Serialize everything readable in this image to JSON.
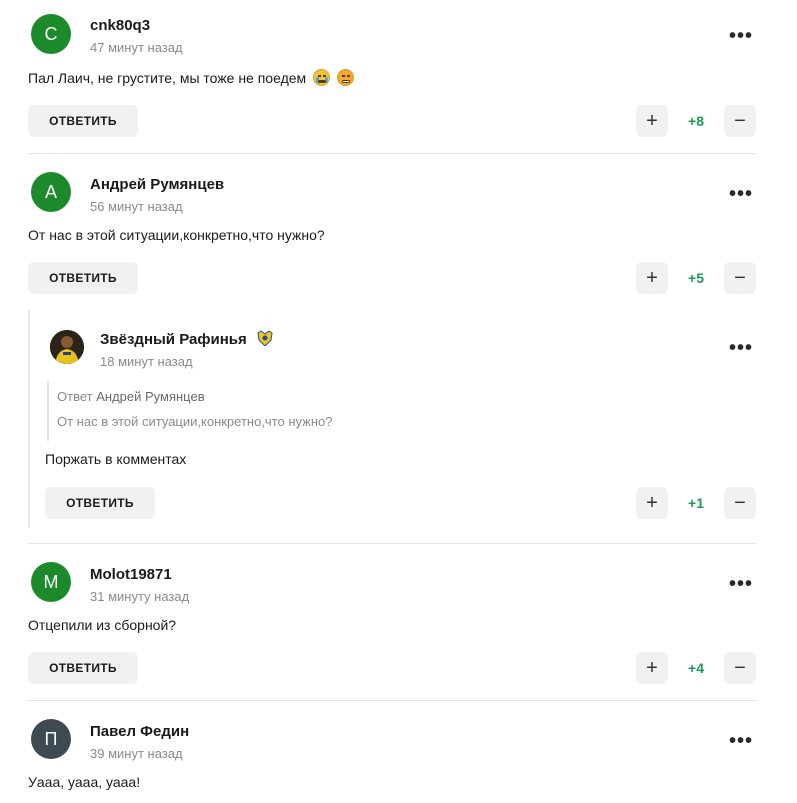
{
  "comments": [
    {
      "author": "cnk80q3",
      "avatar_letter": "C",
      "time": "47 минут назад",
      "text": "Пал Лаич, не грустите, мы тоже не поедем",
      "emojis": [
        "loudly-crying-face-emoji",
        "face-with-symbols-emoji"
      ],
      "reply_label": "ОТВЕТИТЬ",
      "score": "+8"
    },
    {
      "author": "Андрей Румянцев",
      "avatar_letter": "А",
      "time": "56 минут назад",
      "text": "От нас в этой ситуации,конкретно,что нужно?",
      "reply_label": "ОТВЕТИТЬ",
      "score": "+5"
    },
    {
      "author": "Molot19871",
      "avatar_letter": "M",
      "time": "31 минуту назад",
      "text": "Отцепили из сборной?",
      "reply_label": "ОТВЕТИТЬ",
      "score": "+4"
    },
    {
      "author": "Павел Федин",
      "avatar_letter": "П",
      "time": "39 минут назад",
      "text": "Уааа, уааа, уааа!"
    }
  ],
  "reply": {
    "author": "Звёздный Рафинья",
    "badge": "club-badge-icon",
    "time": "18 минут назад",
    "quote_prefix": "Ответ",
    "quote_author": "Андрей Румянцев",
    "quote_text": "От нас в этой ситуации,конкретно,что нужно?",
    "text": "Поржать в комментах",
    "reply_label": "ОТВЕТИТЬ",
    "score": "+1"
  },
  "controls": {
    "upvote": "+",
    "downvote": "−",
    "more": "•••"
  },
  "colors": {
    "avatar_green": "#1c8a2b",
    "avatar_slate": "#3d4a52",
    "score_green": "#1e9b57",
    "button_bg": "#f1f1f1"
  }
}
